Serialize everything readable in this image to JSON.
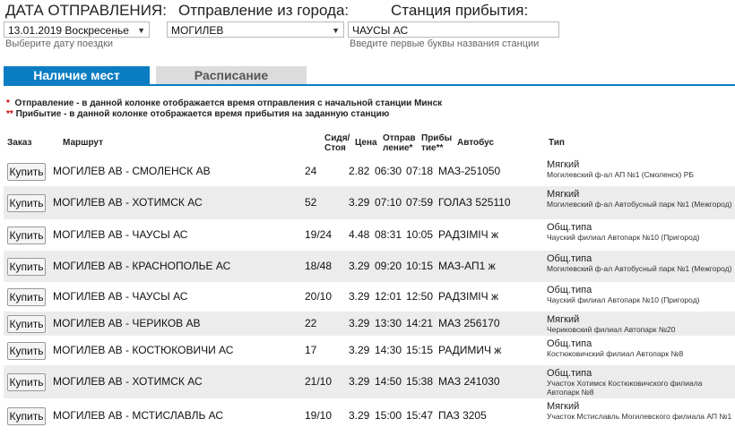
{
  "header": {
    "date_label": "ДАТА ОТПРАВЛЕНИЯ:",
    "city_label": "Отправление из города:",
    "station_label": "Станция прибытия:",
    "date_value": "13.01.2019 Воскресенье",
    "city_value": "МОГИЛЕВ",
    "station_value": "ЧАУСЫ АС",
    "date_hint": "Выберите дату поездки",
    "station_hint": "Введите первые буквы названия станции"
  },
  "tabs": [
    {
      "label": "Наличие мест",
      "active": true
    },
    {
      "label": "Расписание",
      "active": false
    }
  ],
  "notes": [
    {
      "star": "*",
      "text": "Отправление - в данной колонке отображается время отправления с начальной станции Минск"
    },
    {
      "star": "**",
      "text": "Прибытие - в данной колонке отображается время прибытия на заданную станцию"
    }
  ],
  "columns": {
    "order": "Заказ",
    "route": "Маршрут",
    "seats_l1": "Сидя/",
    "seats_l2": "Стоя",
    "price": "Цена",
    "dep_l1": "Отправ",
    "dep_l2": "ление*",
    "arr_l1": "Прибы",
    "arr_l2": "тие**",
    "bus": "Автобус",
    "type": "Тип"
  },
  "buy_label": "Купить",
  "colors": {
    "accent": "#0a7dc3",
    "alt_row": "#ececec",
    "star": "#cc0000"
  },
  "rows": [
    {
      "route": "МОГИЛЕВ АВ - СМОЛЕНСК АВ",
      "seats": "24",
      "price": "2.82",
      "dep": "06:30",
      "arr": "07:18",
      "bus": "МАЗ-251050",
      "type": "Мягкий",
      "carrier": "Могилевский ф-ал АП №1 (Смоленск) РБ"
    },
    {
      "route": "МОГИЛЕВ АВ - ХОТИМСК АС",
      "seats": "52",
      "price": "3.29",
      "dep": "07:10",
      "arr": "07:59",
      "bus": "ГОЛАЗ 525110",
      "type": "Мягкий",
      "carrier": "Могилевский ф-ал Автобусный парк №1 (Межгород)"
    },
    {
      "route": "МОГИЛЕВ АВ - ЧАУСЫ АС",
      "seats": "19/24",
      "price": "4.48",
      "dep": "08:31",
      "arr": "10:05",
      "bus": "РАДЗІМІЧ ж",
      "type": "Общ.типа",
      "carrier": "Чауский филиал Автопарк №10 (Пригород)"
    },
    {
      "route": "МОГИЛЕВ АВ - КРАСНОПОЛЬЕ АС",
      "seats": "18/48",
      "price": "3.29",
      "dep": "09:20",
      "arr": "10:15",
      "bus": "МАЗ-АП1 ж",
      "type": "Общ.типа",
      "carrier": "Могилевский ф-ал Автобусный парк №1 (Межгород)"
    },
    {
      "route": "МОГИЛЕВ АВ - ЧАУСЫ АС",
      "seats": "20/10",
      "price": "3.29",
      "dep": "12:01",
      "arr": "12:50",
      "bus": "РАДЗІМІЧ ж",
      "type": "Общ.типа",
      "carrier": "Чауский филиал Автопарк №10 (Пригород)"
    },
    {
      "route": "МОГИЛЕВ АВ - ЧЕРИКОВ АВ",
      "seats": "22",
      "price": "3.29",
      "dep": "13:30",
      "arr": "14:21",
      "bus": "МАЗ 256170",
      "type": "Мягкий",
      "carrier": "Чериковский филиал Автопарк №20"
    },
    {
      "route": "МОГИЛЕВ АВ - КОСТЮКОВИЧИ АС",
      "seats": "17",
      "price": "3.29",
      "dep": "14:30",
      "arr": "15:15",
      "bus": "РАДИМИЧ ж",
      "type": "Общ.типа",
      "carrier": "Костюковичский филиал Автопарк №8"
    },
    {
      "route": "МОГИЛЕВ АВ - ХОТИМСК АС",
      "seats": "21/10",
      "price": "3.29",
      "dep": "14:50",
      "arr": "15:38",
      "bus": "МАЗ 241030",
      "type": "Общ.типа",
      "carrier": "Участок Хотимск Костюковичского филиала Автопарк №8"
    },
    {
      "route": "МОГИЛЕВ АВ - МСТИСЛАВЛЬ АС",
      "seats": "19/10",
      "price": "3.29",
      "dep": "15:00",
      "arr": "15:47",
      "bus": "ПАЗ 3205",
      "type": "Мягкий",
      "carrier": "Участок Мстиславль Могилевского филиала АП №1"
    }
  ]
}
